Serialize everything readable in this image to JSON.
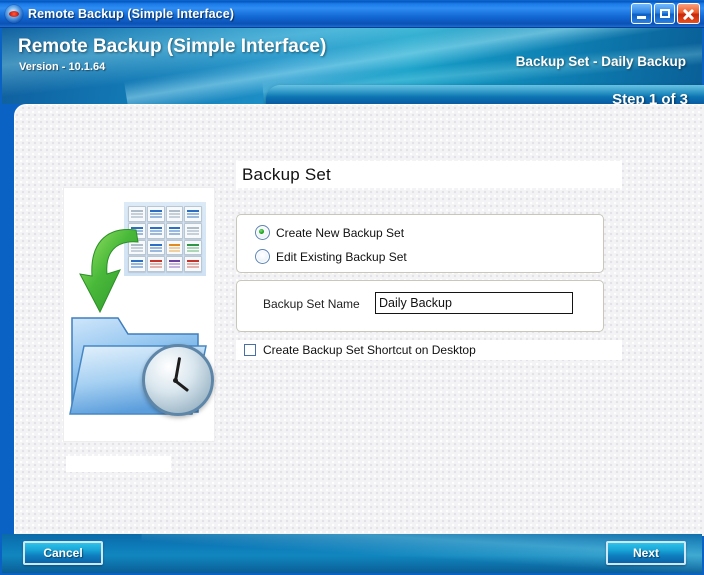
{
  "window": {
    "title": "Remote Backup (Simple Interface)",
    "icon": "app-eye-icon",
    "minimize_label": "",
    "maximize_label": "",
    "close_label": ""
  },
  "banner": {
    "title": "Remote Backup (Simple Interface)",
    "version": "Version - 10.1.64",
    "context": "Backup Set - Daily Backup",
    "step": "Step 1 of 3"
  },
  "main": {
    "heading": "Backup Set",
    "illustration_name": "scheduled-backup-illustration",
    "radio_options": [
      {
        "label": "Create New Backup Set",
        "selected": true
      },
      {
        "label": "Edit Existing Backup Set",
        "selected": false
      }
    ],
    "name_field": {
      "label": "Backup Set Name",
      "value": "Daily Backup",
      "placeholder": ""
    },
    "shortcut_checkbox": {
      "label": "Create Backup Set Shortcut on Desktop",
      "checked": false
    }
  },
  "footer": {
    "cancel_label": "Cancel",
    "next_label": "Next"
  },
  "colors": {
    "titlebar_blue": "#1a7ae8",
    "banner_teal": "#1f93c9",
    "footer_blue": "#0d7ab8",
    "accent_green": "#17a017",
    "close_red": "#c9260a",
    "content_bg": "#f3f3f5"
  }
}
